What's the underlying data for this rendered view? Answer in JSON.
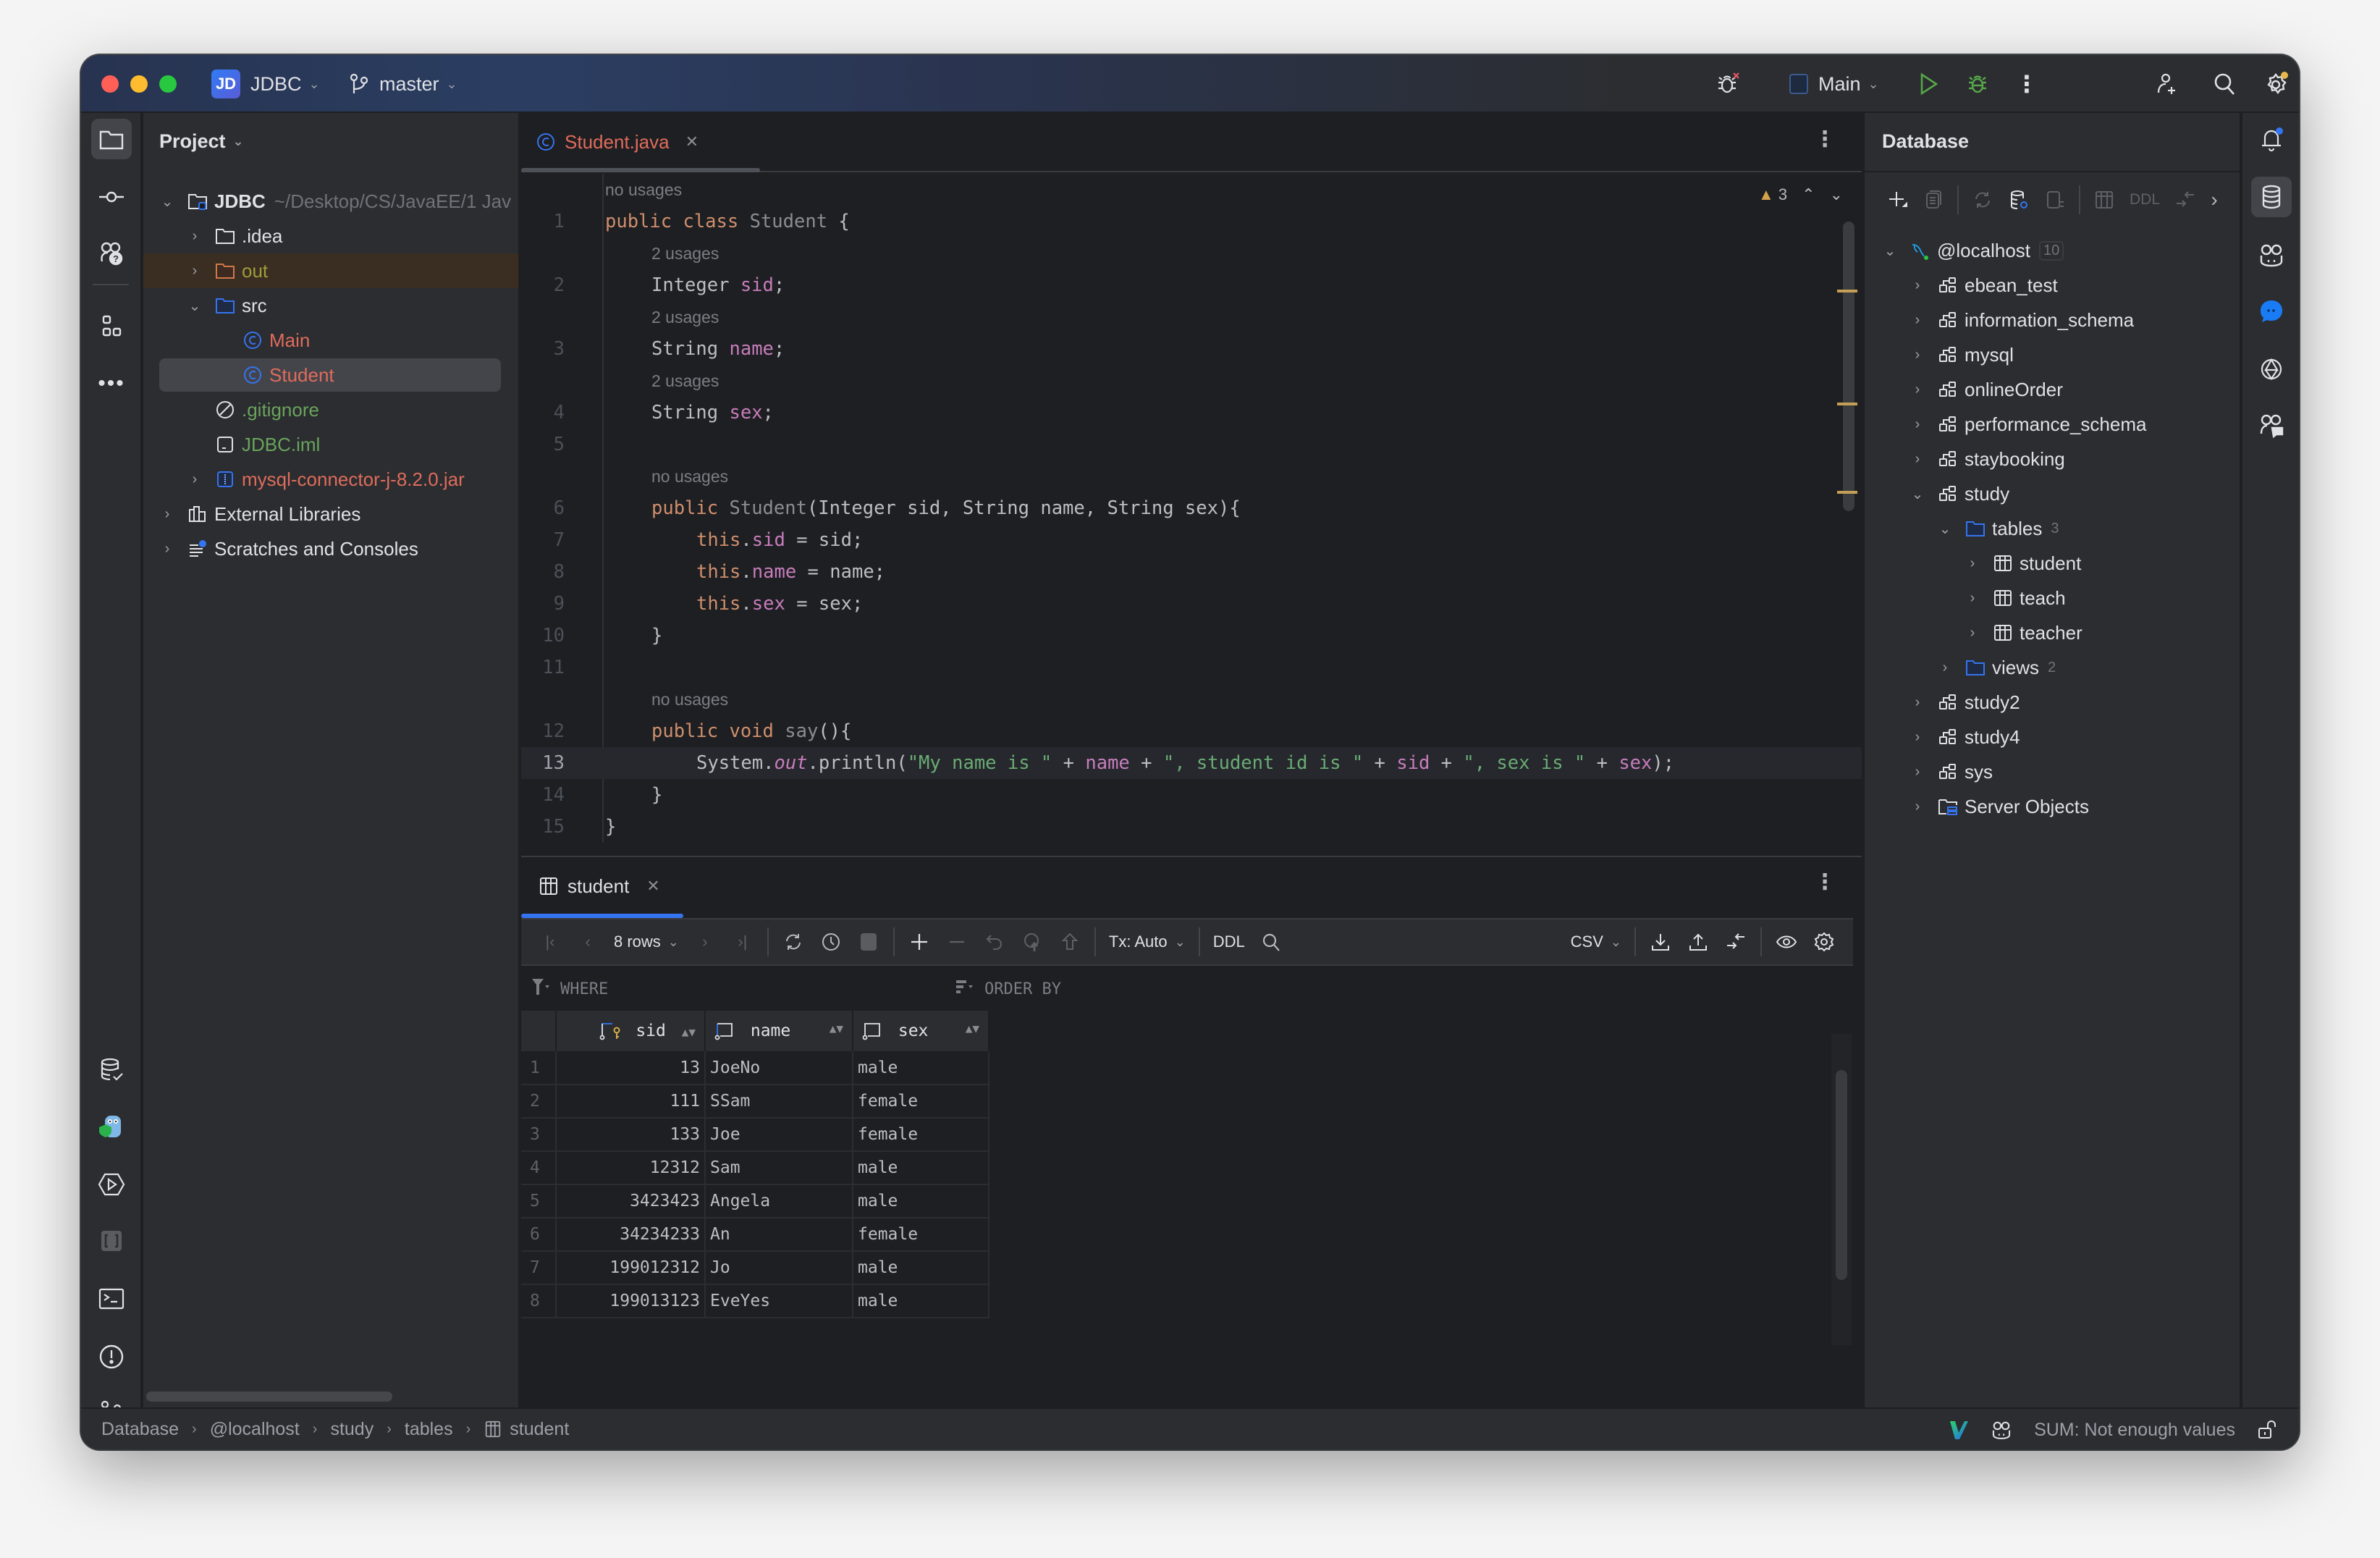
{
  "titlebar": {
    "project_badge": "JD",
    "project_name": "JDBC",
    "branch": "master",
    "run_config": "Main",
    "icons": [
      "debug-error-icon",
      "run-icon",
      "debug-icon",
      "more-icon",
      "add-user-icon",
      "search-icon",
      "settings-icon"
    ]
  },
  "project_panel": {
    "title": "Project",
    "tree": [
      {
        "label": "JDBC",
        "suffix": "~/Desktop/CS/JavaEE/1 Jav",
        "icon": "module-folder-icon",
        "expanded": true
      },
      {
        "label": ".idea",
        "icon": "folder-icon",
        "expanded": false
      },
      {
        "label": "out",
        "icon": "folder-excluded-icon",
        "expanded": false
      },
      {
        "label": "src",
        "icon": "source-folder-icon",
        "expanded": true
      },
      {
        "label": "Main",
        "icon": "class-icon"
      },
      {
        "label": "Student",
        "icon": "class-icon",
        "selected": true
      },
      {
        "label": ".gitignore",
        "icon": "ignore-file-icon"
      },
      {
        "label": "JDBC.iml",
        "icon": "iml-file-icon"
      },
      {
        "label": "mysql-connector-j-8.2.0.jar",
        "icon": "jar-icon",
        "expanded": false
      },
      {
        "label": "External Libraries",
        "icon": "libraries-icon",
        "expanded": false
      },
      {
        "label": "Scratches and Consoles",
        "icon": "scratches-icon",
        "expanded": false
      }
    ]
  },
  "editor": {
    "tab_label": "Student.java",
    "warnings_count": "3",
    "hints": {
      "no_usages": "no usages",
      "two_usages": "2 usages"
    },
    "lines": {
      "l1": {
        "n": "1",
        "kw": "public class",
        "cls": "Student",
        "rest": " {"
      },
      "l2": {
        "n": "2",
        "type": "Integer",
        "field": "sid",
        "rest": ";"
      },
      "l3": {
        "n": "3",
        "type": "String",
        "field": "name",
        "rest": ";"
      },
      "l4": {
        "n": "4",
        "type": "String",
        "field": "sex",
        "rest": ";"
      },
      "l5": {
        "n": "5"
      },
      "l6": {
        "n": "6",
        "kw": "public",
        "cls": "Student",
        "rest": "(Integer sid, String name, String sex){"
      },
      "l7": {
        "n": "7",
        "kw": "this",
        "field": "sid",
        "rest": " = sid;"
      },
      "l8": {
        "n": "8",
        "kw": "this",
        "field": "name",
        "rest": " = name;"
      },
      "l9": {
        "n": "9",
        "kw": "this",
        "field": "sex",
        "rest": " = sex;"
      },
      "l10": {
        "n": "10",
        "text": "}"
      },
      "l11": {
        "n": "11"
      },
      "l12": {
        "n": "12",
        "kw": "public void",
        "cls": "say",
        "rest": "(){"
      },
      "l13": {
        "n": "13",
        "pre": "System.",
        "out": "out",
        "mid": ".println(",
        "s1": "\"My name is \"",
        "p1": " + ",
        "f1": "name",
        "p2": " + ",
        "s2": "\", student id is \"",
        "p3": " + ",
        "f2": "sid",
        "p4": " + ",
        "s3": "\", sex is \"",
        "p5": " + ",
        "f3": "sex",
        "end": ");"
      },
      "l14": {
        "n": "14",
        "text": "}"
      },
      "l15": {
        "n": "15",
        "text": "}"
      }
    }
  },
  "data_panel": {
    "tab_label": "student",
    "rows_label": "8 rows",
    "tx_label": "Tx: Auto",
    "ddl_label": "DDL",
    "export_format": "CSV",
    "where_label": "WHERE",
    "order_by_label": "ORDER BY",
    "columns": [
      "sid",
      "name",
      "sex"
    ],
    "rows": [
      {
        "n": "1",
        "sid": "13",
        "name": "JoeNo",
        "sex": "male"
      },
      {
        "n": "2",
        "sid": "111",
        "name": "SSam",
        "sex": "female"
      },
      {
        "n": "3",
        "sid": "133",
        "name": "Joe",
        "sex": "female"
      },
      {
        "n": "4",
        "sid": "12312",
        "name": "Sam",
        "sex": "male"
      },
      {
        "n": "5",
        "sid": "3423423",
        "name": "Angela",
        "sex": "male"
      },
      {
        "n": "6",
        "sid": "34234233",
        "name": "An",
        "sex": "female"
      },
      {
        "n": "7",
        "sid": "199012312",
        "name": "Jo",
        "sex": "male"
      },
      {
        "n": "8",
        "sid": "199013123",
        "name": "EveYes",
        "sex": "male"
      }
    ]
  },
  "database_panel": {
    "title": "Database",
    "toolbar_ddl": "DDL",
    "tree": [
      {
        "label": "@localhost",
        "count": "10",
        "icon": "mysql-icon",
        "expanded": true
      },
      {
        "label": "ebean_test",
        "icon": "schema-icon"
      },
      {
        "label": "information_schema",
        "icon": "schema-icon"
      },
      {
        "label": "mysql",
        "icon": "schema-icon"
      },
      {
        "label": "onlineOrder",
        "icon": "schema-icon"
      },
      {
        "label": "performance_schema",
        "icon": "schema-icon"
      },
      {
        "label": "staybooking",
        "icon": "schema-icon"
      },
      {
        "label": "study",
        "icon": "schema-icon",
        "expanded": true
      },
      {
        "label": "tables",
        "count": "3",
        "icon": "folder-icon",
        "expanded": true
      },
      {
        "label": "student",
        "icon": "table-icon"
      },
      {
        "label": "teach",
        "icon": "table-icon"
      },
      {
        "label": "teacher",
        "icon": "table-icon"
      },
      {
        "label": "views",
        "count": "2",
        "icon": "folder-icon"
      },
      {
        "label": "study2",
        "icon": "schema-icon"
      },
      {
        "label": "study4",
        "icon": "schema-icon"
      },
      {
        "label": "sys",
        "icon": "schema-icon"
      },
      {
        "label": "Server Objects",
        "icon": "server-objects-icon"
      }
    ]
  },
  "statusbar": {
    "breadcrumb": [
      "Database",
      "@localhost",
      "study",
      "tables",
      "student"
    ],
    "sum_text": "SUM: Not enough values"
  },
  "colors": {
    "accent": "#3574f0",
    "keyword": "#cf8e6d",
    "field": "#c77dbb",
    "string": "#6aab73",
    "warning": "#d4a24c",
    "error_file": "#e06c5c",
    "vcs_added": "#6aa35c"
  }
}
